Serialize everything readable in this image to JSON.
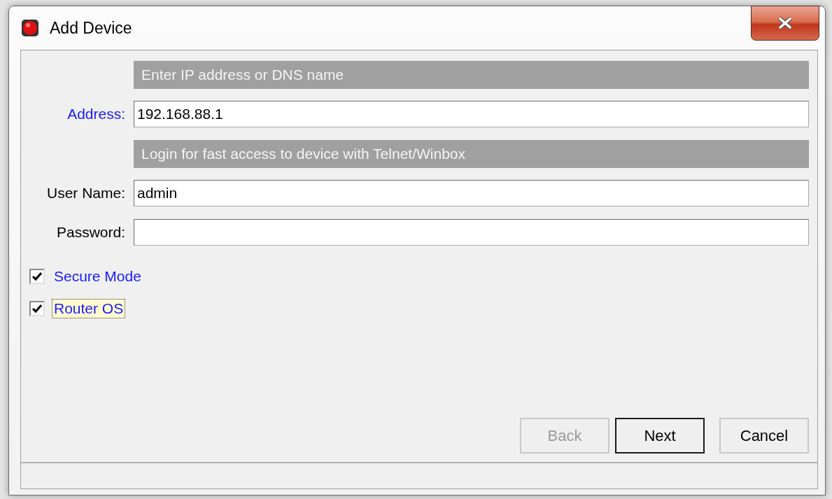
{
  "window": {
    "title": "Add Device"
  },
  "form": [
    {
      "kind": "header",
      "text": "Enter IP address or DNS name"
    },
    {
      "kind": "field",
      "label": "Address:",
      "accent": true,
      "value": "192.168.88.1"
    },
    {
      "kind": "header",
      "text": "Login for fast access to device with Telnet/Winbox"
    },
    {
      "kind": "field",
      "label": "User Name:",
      "accent": false,
      "value": "admin"
    },
    {
      "kind": "field",
      "label": "Password:",
      "accent": false
    }
  ],
  "checkboxes": [
    {
      "label": "Secure Mode",
      "checked": true,
      "focused": false
    },
    {
      "label": "Router OS",
      "checked": true,
      "focused": true
    }
  ],
  "buttons": [
    {
      "label": "Back",
      "disabled": true,
      "default": false
    },
    {
      "label": "Next",
      "disabled": false,
      "default": true
    },
    {
      "label": "Cancel",
      "disabled": false,
      "default": false
    }
  ]
}
